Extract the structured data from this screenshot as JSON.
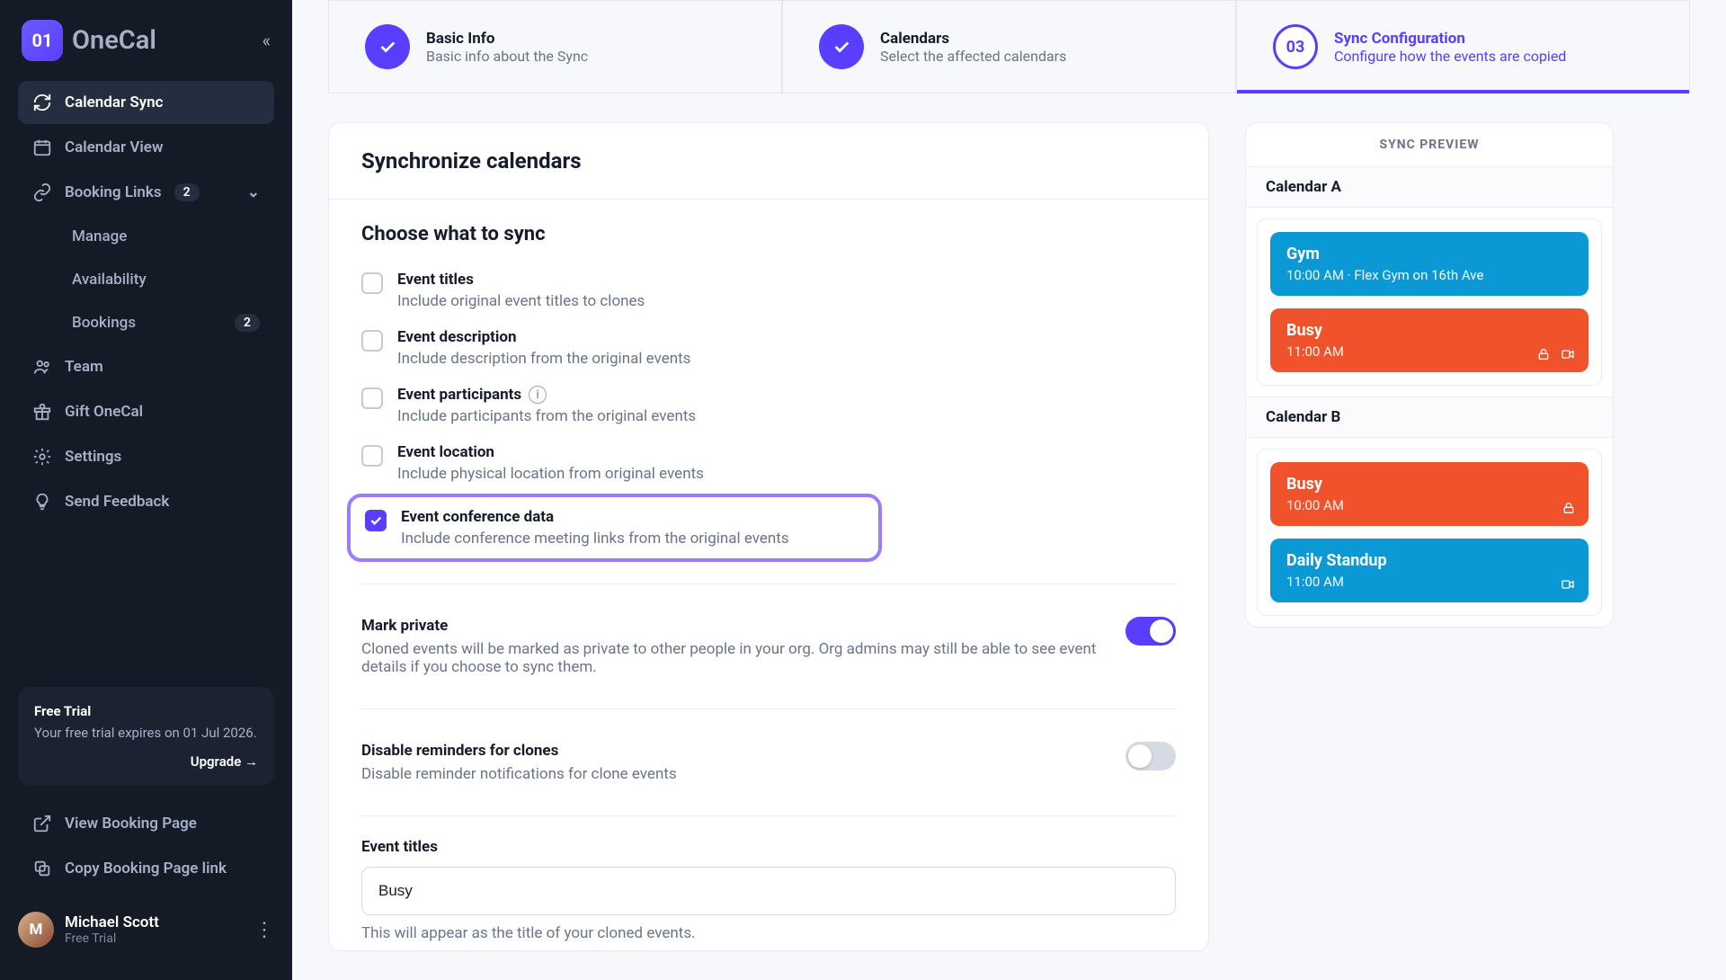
{
  "brand": {
    "badge": "01",
    "name": "OneCal"
  },
  "sidebar": {
    "items": [
      {
        "label": "Calendar Sync"
      },
      {
        "label": "Calendar View"
      },
      {
        "label": "Booking Links",
        "badge": "2"
      },
      {
        "label": "Manage"
      },
      {
        "label": "Availability"
      },
      {
        "label": "Bookings",
        "badge": "2"
      },
      {
        "label": "Team"
      },
      {
        "label": "Gift OneCal"
      },
      {
        "label": "Settings"
      },
      {
        "label": "Send Feedback"
      }
    ],
    "trial": {
      "title": "Free Trial",
      "text": "Your free trial expires on 01 Jul 2026.",
      "upgrade": "Upgrade →"
    },
    "bottom": [
      {
        "label": "View Booking Page"
      },
      {
        "label": "Copy Booking Page link"
      }
    ],
    "user": {
      "name": "Michael Scott",
      "plan": "Free Trial"
    }
  },
  "stepper": [
    {
      "title": "Basic Info",
      "sub": "Basic info about the Sync"
    },
    {
      "title": "Calendars",
      "sub": "Select the affected calendars"
    },
    {
      "num": "03",
      "title": "Sync Configuration",
      "sub": "Configure how the events are copied"
    }
  ],
  "main": {
    "header": "Synchronize calendars",
    "choose_title": "Choose what to sync",
    "options": [
      {
        "title": "Event titles",
        "sub": "Include original event titles to clones",
        "checked": false
      },
      {
        "title": "Event description",
        "sub": "Include description from the original events",
        "checked": false
      },
      {
        "title": "Event participants",
        "sub": "Include participants from the original events",
        "checked": false,
        "info": true
      },
      {
        "title": "Event location",
        "sub": "Include physical location from original events",
        "checked": false
      },
      {
        "title": "Event conference data",
        "sub": "Include conference meeting links from the original events",
        "checked": true,
        "highlight": true
      }
    ],
    "mark_private": {
      "title": "Mark private",
      "sub": "Cloned events will be marked as private to other people in your org. Org admins may still be able to see event details if you choose to sync them.",
      "on": true
    },
    "disable_reminders": {
      "title": "Disable reminders for clones",
      "sub": "Disable reminder notifications for clone events",
      "on": false
    },
    "event_titles": {
      "label": "Event titles",
      "value": "Busy",
      "hint": "This will appear as the title of your cloned events."
    }
  },
  "preview": {
    "header": "SYNC PREVIEW",
    "calendars": [
      {
        "name": "Calendar A",
        "events": [
          {
            "title": "Gym",
            "time": "10:00 AM · Flex Gym on 16th Ave",
            "color": "blue"
          },
          {
            "title": "Busy",
            "time": "11:00 AM",
            "color": "orange",
            "icons": [
              "lock",
              "video"
            ]
          }
        ]
      },
      {
        "name": "Calendar B",
        "events": [
          {
            "title": "Busy",
            "time": "10:00 AM",
            "color": "orange",
            "icons": [
              "lock"
            ]
          },
          {
            "title": "Daily Standup",
            "time": "11:00 AM",
            "color": "blue",
            "icons": [
              "video"
            ]
          }
        ]
      }
    ]
  }
}
